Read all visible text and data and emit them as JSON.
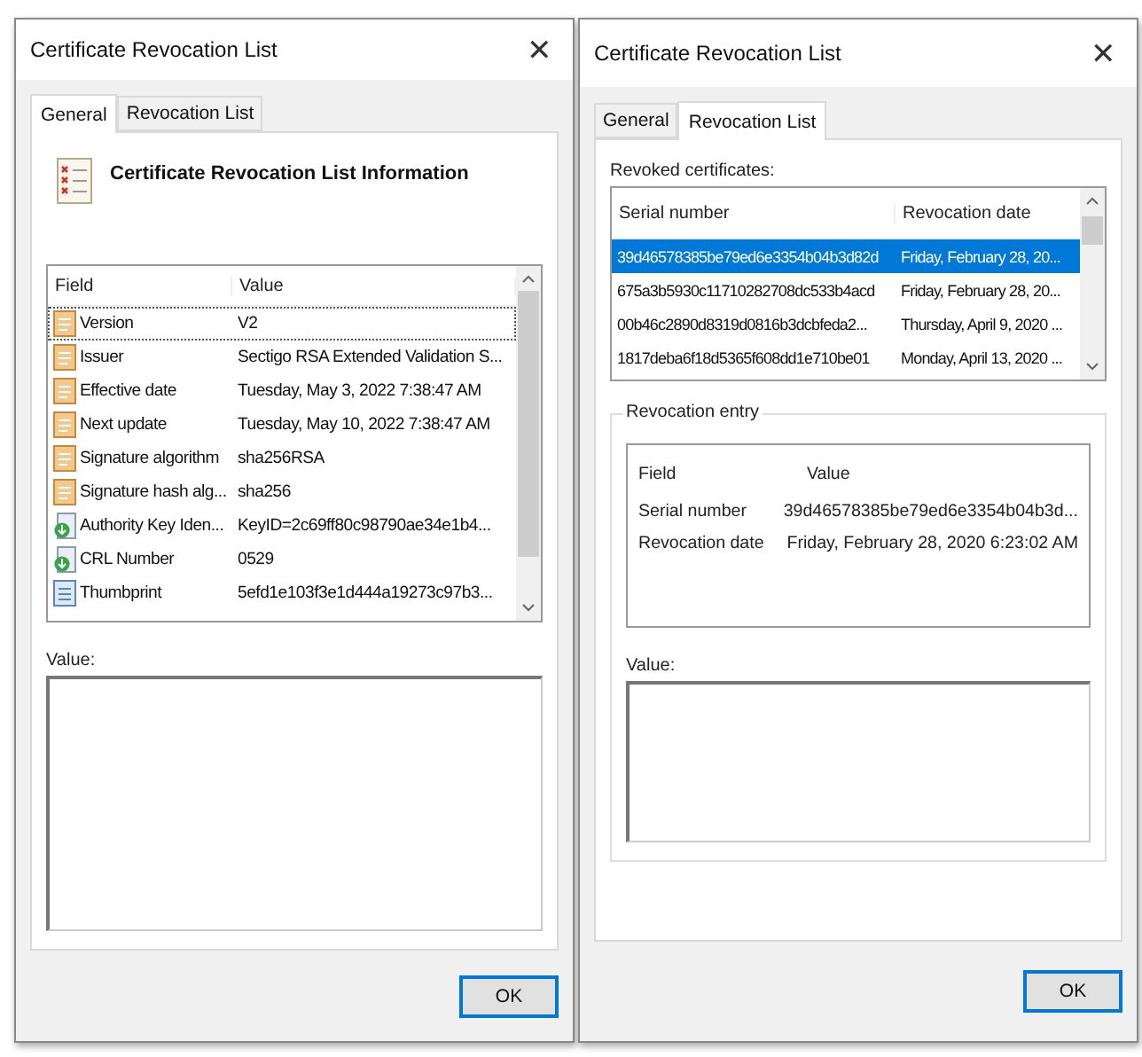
{
  "dialogs": [
    {
      "title": "Certificate Revocation List",
      "tabs": [
        {
          "label": "General",
          "selected": true
        },
        {
          "label": "Revocation List",
          "selected": false
        }
      ],
      "kind": "general",
      "close": "✕",
      "header": "Certificate Revocation List Information",
      "list": {
        "columns": [
          "Field",
          "Value"
        ],
        "rows": [
          {
            "kind": "property",
            "field": "Version",
            "value": "V2",
            "selected": true
          },
          {
            "kind": "property",
            "field": "Issuer",
            "value": "Sectigo RSA Extended Validation S...",
            "selected": false
          },
          {
            "kind": "property",
            "field": "Effective date",
            "value": "Tuesday, May 3, 2022 7:38:47 AM",
            "selected": false
          },
          {
            "kind": "property",
            "field": "Next update",
            "value": "Tuesday, May 10, 2022 7:38:47 AM",
            "selected": false
          },
          {
            "kind": "property",
            "field": "Signature algorithm",
            "value": "sha256RSA",
            "selected": false
          },
          {
            "kind": "property",
            "field": "Signature hash alg...",
            "value": "sha256",
            "selected": false
          },
          {
            "kind": "extension",
            "field": "Authority Key Iden...",
            "value": "KeyID=2c69ff80c98790ae34e1b4...",
            "selected": false
          },
          {
            "kind": "extension",
            "field": "CRL Number",
            "value": "0529",
            "selected": false
          },
          {
            "kind": "thumbprint",
            "field": "Thumbprint",
            "value": "5efd1e103f3e1d444a19273c97b3...",
            "selected": false
          }
        ]
      },
      "value_label": "Value:",
      "ok": "OK"
    },
    {
      "title": "Certificate Revocation List",
      "tabs": [
        {
          "label": "General",
          "selected": false
        },
        {
          "label": "Revocation List",
          "selected": true
        }
      ],
      "kind": "revocation",
      "close": "✕",
      "revoked_label": "Revoked certificates:",
      "list": {
        "columns": [
          "Serial number",
          "Revocation date"
        ],
        "rows": [
          {
            "field": "39d46578385be79ed6e3354b04b3d82d",
            "value": "Friday, February 28, 20...",
            "selected": true
          },
          {
            "field": "675a3b5930c11710282708dc533b4acd",
            "value": "Friday, February 28, 20...",
            "selected": false
          },
          {
            "field": "00b46c2890d8319d0816b3dcbfeda2...",
            "value": "Thursday, April 9, 2020 ...",
            "selected": false
          },
          {
            "field": "1817deba6f18d5365f608dd1e710be01",
            "value": "Monday, April 13, 2020 ...",
            "selected": false
          }
        ]
      },
      "entry": {
        "legend": "Revocation entry",
        "columns": [
          "Field",
          "Value"
        ],
        "rows": [
          {
            "field": "Serial number",
            "value": "39d46578385be79ed6e3354b04b3d..."
          },
          {
            "field": "Revocation date",
            "value": "Friday, February 28, 2020 6:23:02 AM"
          }
        ]
      },
      "value_label": "Value:",
      "ok": "OK"
    }
  ]
}
